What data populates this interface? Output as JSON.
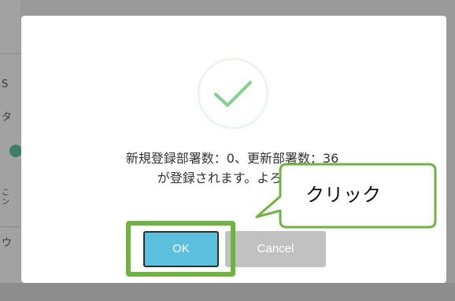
{
  "background": {
    "fragments": [
      "S",
      "タ",
      "こ",
      "ン",
      "ウ"
    ]
  },
  "dialog": {
    "icon": "checkmark-circle-icon",
    "message_line1": "新規登録部署数：0、更新部署数：36",
    "message_line2": "が登録されます。よろしい",
    "ok_label": "OK",
    "cancel_label": "Cancel"
  },
  "annotation": {
    "callout_text": "クリック",
    "highlight_color": "#6fb43f"
  },
  "colors": {
    "ok_button": "#5bc0de",
    "cancel_button": "#c1c1c1",
    "check_stroke": "#7fd38a",
    "overlay": "#9a9a9a"
  }
}
